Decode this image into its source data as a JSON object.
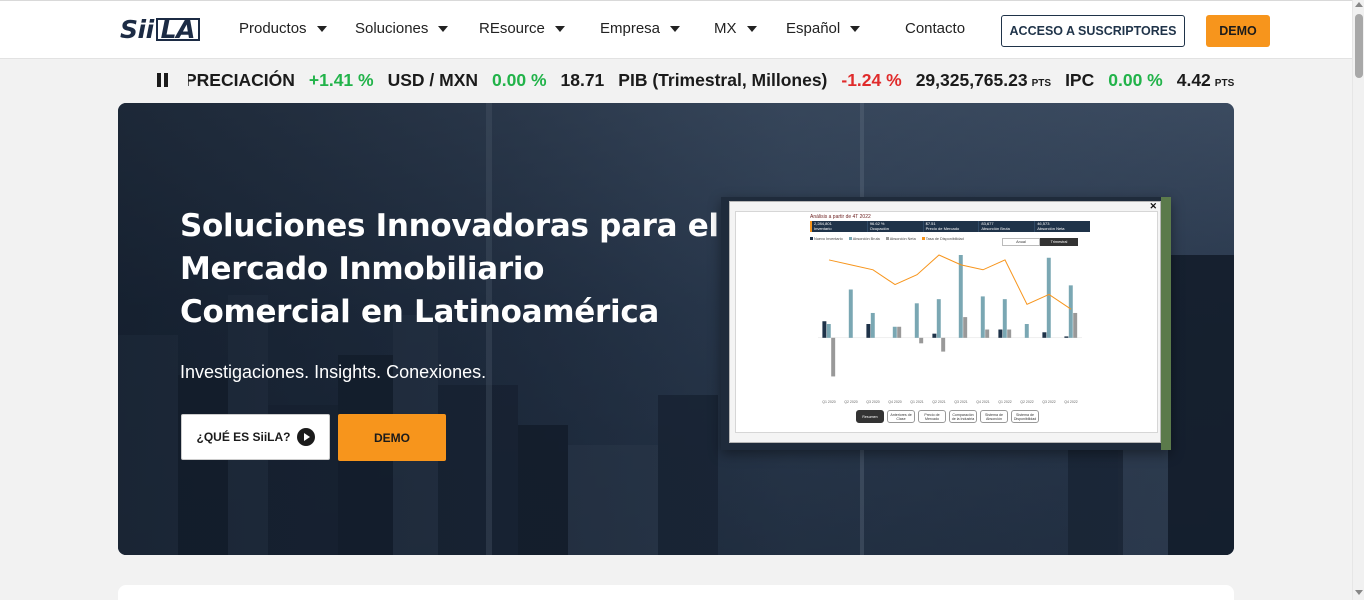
{
  "nav": {
    "logo": {
      "prefix": "Sii",
      "boxed": "LA"
    },
    "items": [
      {
        "label": "Productos",
        "has_dropdown": true
      },
      {
        "label": "Soluciones",
        "has_dropdown": true
      },
      {
        "label": "REsource",
        "has_dropdown": true
      },
      {
        "label": "Empresa",
        "has_dropdown": true
      },
      {
        "label": "MX",
        "has_dropdown": true
      },
      {
        "label": "Español",
        "has_dropdown": true
      },
      {
        "label": "Contacto",
        "has_dropdown": false
      }
    ],
    "subscriber_button": "ACCESO A SUSCRIPTORES",
    "demo_button": "DEMO"
  },
  "ticker": {
    "items": [
      {
        "label": "PRECIACIÓN",
        "change": "+1.41 %",
        "trend": "up"
      },
      {
        "label": "USD / MXN",
        "change": "0.00 %",
        "trend": "up",
        "value": "18.71"
      },
      {
        "label": "PIB (Trimestral, Millones)",
        "change": "-1.24 %",
        "trend": "down",
        "value": "29,325,765.23",
        "unit": "PTS"
      },
      {
        "label": "IPC",
        "change": "0.00 %",
        "trend": "up",
        "value": "4.42",
        "unit": "PTS"
      }
    ]
  },
  "hero": {
    "title": "Soluciones Innovadoras para el Mercado Inmobiliario Comercial en Latinoamérica",
    "subtitle": "Investigaciones. Insights. Conexiones.",
    "what_button": "¿QUÉ ES SiiLA?",
    "demo_button": "DEMO"
  },
  "dashboard": {
    "title": "Análisis a partir de 4T 2022",
    "kpis": [
      {
        "value": "2,284,801",
        "label": "Inventario"
      },
      {
        "value": "96.62 %",
        "label": "Ocupación"
      },
      {
        "value": "$7.51",
        "label": "Precio de Mercado"
      },
      {
        "value": "83,677",
        "label": "Absorción Bruta"
      },
      {
        "value": "46,573",
        "label": "Absorción Neta"
      }
    ],
    "legend": [
      {
        "label": "Nuevo Inventario",
        "color": "#1f3349"
      },
      {
        "label": "Absorción Bruta",
        "color": "#7aa7b3"
      },
      {
        "label": "Absorción Neta",
        "color": "#999999"
      },
      {
        "label": "Tasa de Disponibilidad",
        "color": "#f7951c"
      }
    ],
    "toggle": [
      "Anual",
      "Trimestral"
    ],
    "tabs": [
      "Resumen",
      "Anteriores de Clase",
      "Precio de Mercado",
      "Comparación de la Industria",
      "Sistema de Absorción",
      "Sistema de Disponibilidad"
    ],
    "chart_data": {
      "type": "bar",
      "categories": [
        "Q1 2020",
        "Q2 2020",
        "Q3 2020",
        "Q4 2020",
        "Q1 2021",
        "Q2 2021",
        "Q3 2021",
        "Q4 2021",
        "Q1 2022",
        "Q2 2022",
        "Q3 2022",
        "Q4 2022"
      ],
      "series": [
        {
          "name": "Nuevo Inventario",
          "color": "#1f3349",
          "values": [
            12000,
            0,
            10000,
            0,
            0,
            3000,
            0,
            0,
            6000,
            0,
            4000,
            1000
          ]
        },
        {
          "name": "Absorción Bruta",
          "color": "#7aa7b3",
          "values": [
            10000,
            35000,
            18000,
            8000,
            25000,
            28000,
            60000,
            30000,
            28000,
            10000,
            58000,
            38000
          ]
        },
        {
          "name": "Absorción Neta",
          "color": "#999999",
          "values": [
            -28000,
            0,
            0,
            8000,
            -4000,
            -10000,
            15000,
            6000,
            6000,
            0,
            0,
            18000
          ]
        }
      ],
      "line": {
        "name": "Tasa de Disponibilidad",
        "color": "#f7951c",
        "values": [
          7.5,
          7.0,
          6.5,
          5.0,
          6.0,
          8.0,
          7.0,
          6.5,
          7.5,
          3.0,
          4.0,
          2.5
        ]
      },
      "ylim": [
        -40000,
        60000
      ],
      "y2lim": [
        -6,
        8
      ]
    }
  }
}
